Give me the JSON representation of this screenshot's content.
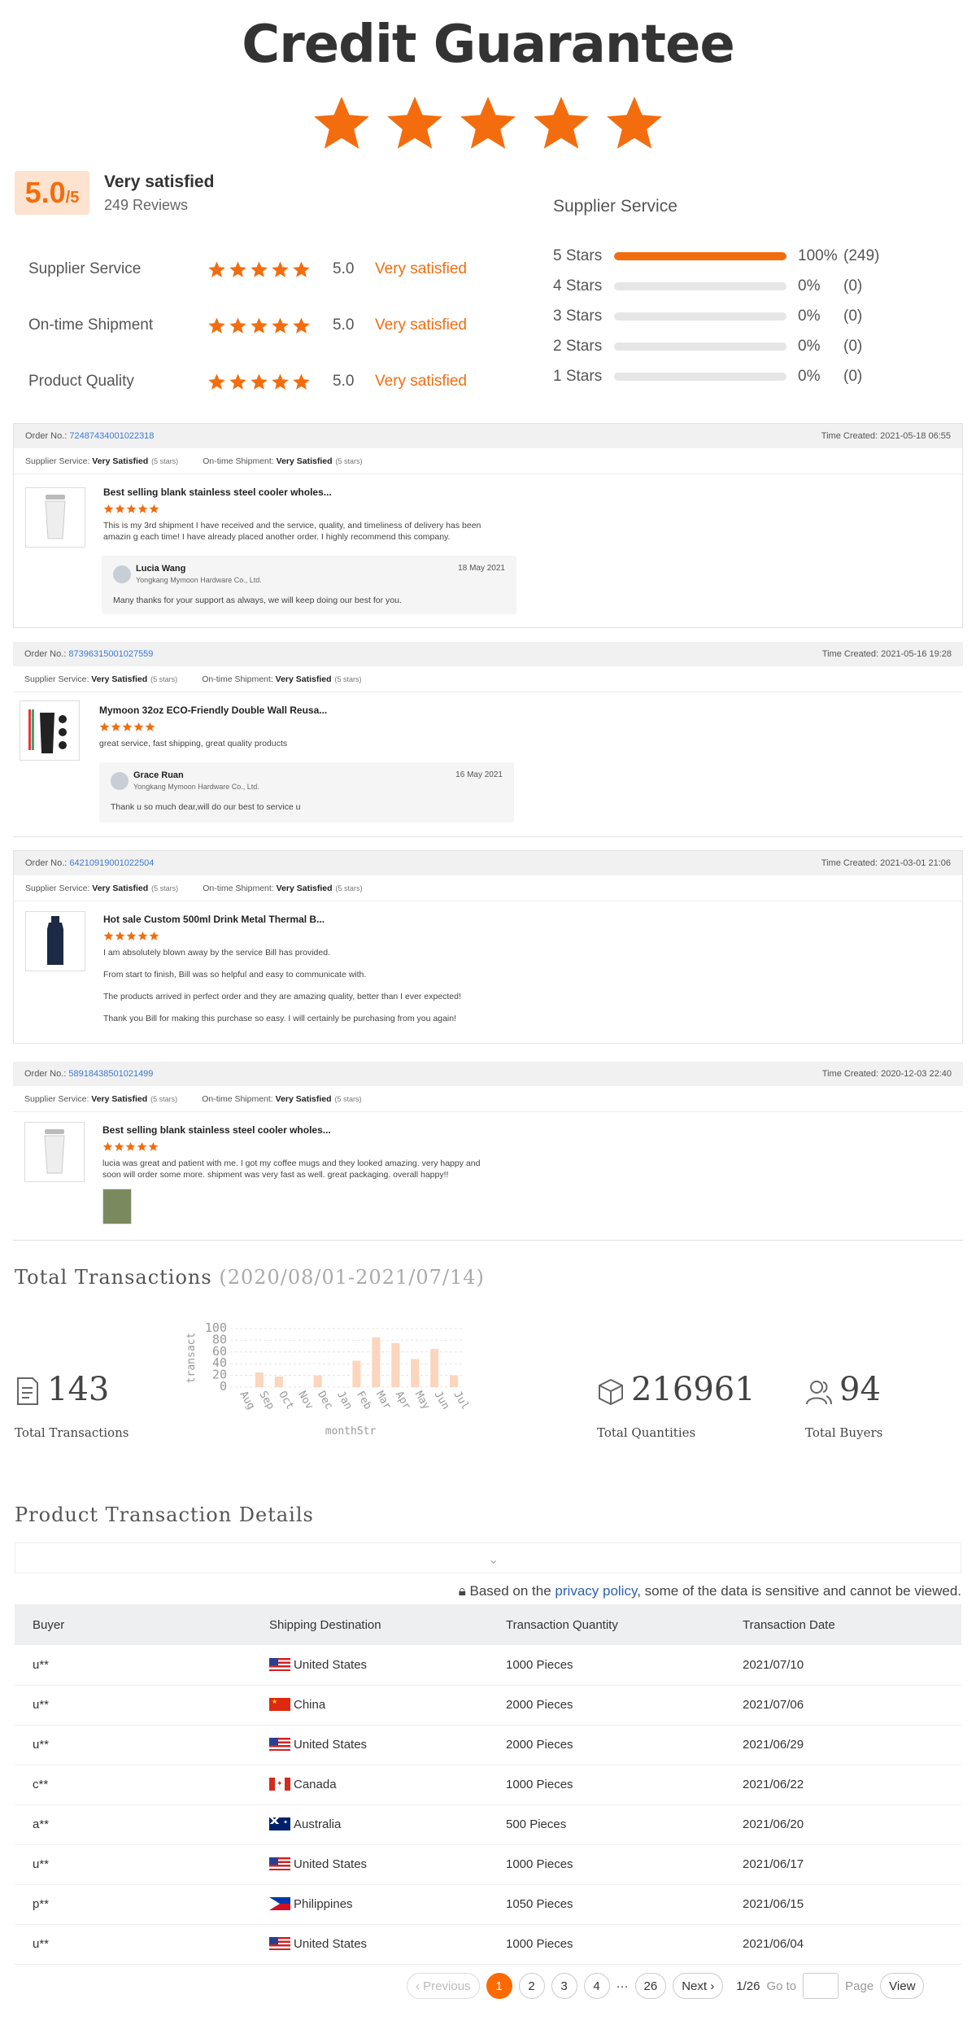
{
  "hero": {
    "title": "Credit Guarantee"
  },
  "summary": {
    "score": "5.0",
    "score_max": "/5",
    "label": "Very satisfied",
    "reviews": "249 Reviews"
  },
  "metrics": [
    {
      "label": "Supplier Service",
      "value": "5.0",
      "word": "Very satisfied",
      "stars": 5
    },
    {
      "label": "On-time Shipment",
      "value": "5.0",
      "word": "Very satisfied",
      "stars": 5
    },
    {
      "label": "Product Quality",
      "value": "5.0",
      "word": "Very satisfied",
      "stars": 5
    }
  ],
  "distribution": {
    "title": "Supplier Service",
    "rows": [
      {
        "label": "5 Stars",
        "pct": "100%",
        "count": "(249)",
        "fraction": 1.0
      },
      {
        "label": "4 Stars",
        "pct": "0%",
        "count": "(0)",
        "fraction": 0
      },
      {
        "label": "3 Stars",
        "pct": "0%",
        "count": "(0)",
        "fraction": 0
      },
      {
        "label": "2 Stars",
        "pct": "0%",
        "count": "(0)",
        "fraction": 0
      },
      {
        "label": "1 Stars",
        "pct": "0%",
        "count": "(0)",
        "fraction": 0
      }
    ]
  },
  "review_labels": {
    "order_no": "Order No.:",
    "time_created": "Time Created:",
    "supplier_service": "Supplier Service:",
    "on_time": "On-time Shipment:",
    "very_satisfied": "Very Satisfied",
    "five_stars": "(5 stars)"
  },
  "reviews": [
    {
      "order": "72487434001022318",
      "time": "2021-05-18 06:55",
      "product": "Best selling blank stainless steel cooler wholes...",
      "text": "This is my 3rd shipment I have received and the service, quality, and timeliness of delivery has been amazin g each time! I have already placed another order. I highly recommend this company.",
      "reply": {
        "name": "Lucia Wang",
        "company": "Yongkang Mymoon Hardware Co., Ltd.",
        "date": "18 May 2021",
        "message": "Many thanks for your support as always, we will keep doing our best for you."
      }
    },
    {
      "order": "87396315001027559",
      "time": "2021-05-16 19:28",
      "product": "Mymoon 32oz ECO-Friendly Double Wall Reusa...",
      "text": "great service, fast shipping, great quality products",
      "reply": {
        "name": "Grace Ruan",
        "company": "Yongkang Mymoon Hardware Co., Ltd.",
        "date": "16 May 2021",
        "message": "Thank u so much dear,will do our best to service u"
      }
    },
    {
      "order": "64210919001022504",
      "time": "2021-03-01 21:06",
      "product": "Hot sale Custom 500ml Drink Metal Thermal B...",
      "lines": [
        "I am absolutely blown away by the service Bill has provided.",
        "From start to finish, Bill was so helpful and easy to communicate with.",
        "The products arrived in perfect order and they are amazing quality, better than I ever expected!",
        "Thank you Bill for making this purchase so easy. I will certainly be purchasing from you again!"
      ]
    },
    {
      "order": "58918438501021499",
      "time": "2020-12-03 22:40",
      "product": "Best selling blank stainless steel cooler wholes...",
      "text": "lucia was great and patient with me. I got my coffee mugs and they looked amazing. very happy and soon will order some more. shipment was very fast as well. great packaging. overall happy!!"
    }
  ],
  "transactions": {
    "title": "Total Transactions",
    "range": "(2020/08/01-2021/07/14)",
    "total_transactions": "143",
    "total_transactions_label": "Total Transactions",
    "total_quantities": "216961",
    "total_quantities_label": "Total Quantities",
    "total_buyers": "94",
    "total_buyers_label": "Total Buyers"
  },
  "chart_data": {
    "type": "bar",
    "ylabel": "transact",
    "xlabel": "monthStr",
    "categories": [
      "Aug",
      "Sep",
      "Oct",
      "Nov",
      "Dec",
      "Jan",
      "Feb",
      "Mar",
      "Apr",
      "May",
      "Jun",
      "Jul"
    ],
    "values": [
      0,
      25,
      18,
      0,
      20,
      0,
      45,
      85,
      75,
      48,
      65,
      20
    ],
    "yticks": [
      0,
      20,
      40,
      60,
      80,
      100
    ],
    "ylim": [
      0,
      100
    ],
    "color": "#fcd5bd"
  },
  "details": {
    "title": "Product Transaction Details",
    "privacy_prefix": "Based on the ",
    "privacy_link": "privacy policy",
    "privacy_suffix": ", some of the data is sensitive and cannot be viewed.",
    "columns": [
      "Buyer",
      "Shipping Destination",
      "Transaction Quantity",
      "Transaction Date"
    ],
    "rows": [
      {
        "buyer": "u**",
        "flag": "us",
        "dest": "United States",
        "qty": "1000 Pieces",
        "date": "2021/07/10"
      },
      {
        "buyer": "u**",
        "flag": "cn",
        "dest": "China",
        "qty": "2000 Pieces",
        "date": "2021/07/06"
      },
      {
        "buyer": "u**",
        "flag": "us",
        "dest": "United States",
        "qty": "2000 Pieces",
        "date": "2021/06/29"
      },
      {
        "buyer": "c**",
        "flag": "ca",
        "dest": "Canada",
        "qty": "1000 Pieces",
        "date": "2021/06/22"
      },
      {
        "buyer": "a**",
        "flag": "au",
        "dest": "Australia",
        "qty": "500 Pieces",
        "date": "2021/06/20"
      },
      {
        "buyer": "u**",
        "flag": "us",
        "dest": "United States",
        "qty": "1000 Pieces",
        "date": "2021/06/17"
      },
      {
        "buyer": "p**",
        "flag": "ph",
        "dest": "Philippines",
        "qty": "1050 Pieces",
        "date": "2021/06/15"
      },
      {
        "buyer": "u**",
        "flag": "us",
        "dest": "United States",
        "qty": "1000 Pieces",
        "date": "2021/06/04"
      }
    ]
  },
  "pagination": {
    "previous": "Previous",
    "pages": [
      "1",
      "2",
      "3",
      "4"
    ],
    "ellipsis": "···",
    "last": "26",
    "next": "Next",
    "page_info": "1/26",
    "goto": "Go to",
    "page_word": "Page",
    "view": "View"
  },
  "colors": {
    "accent": "#f36d0e",
    "link": "#3c7bd5"
  }
}
